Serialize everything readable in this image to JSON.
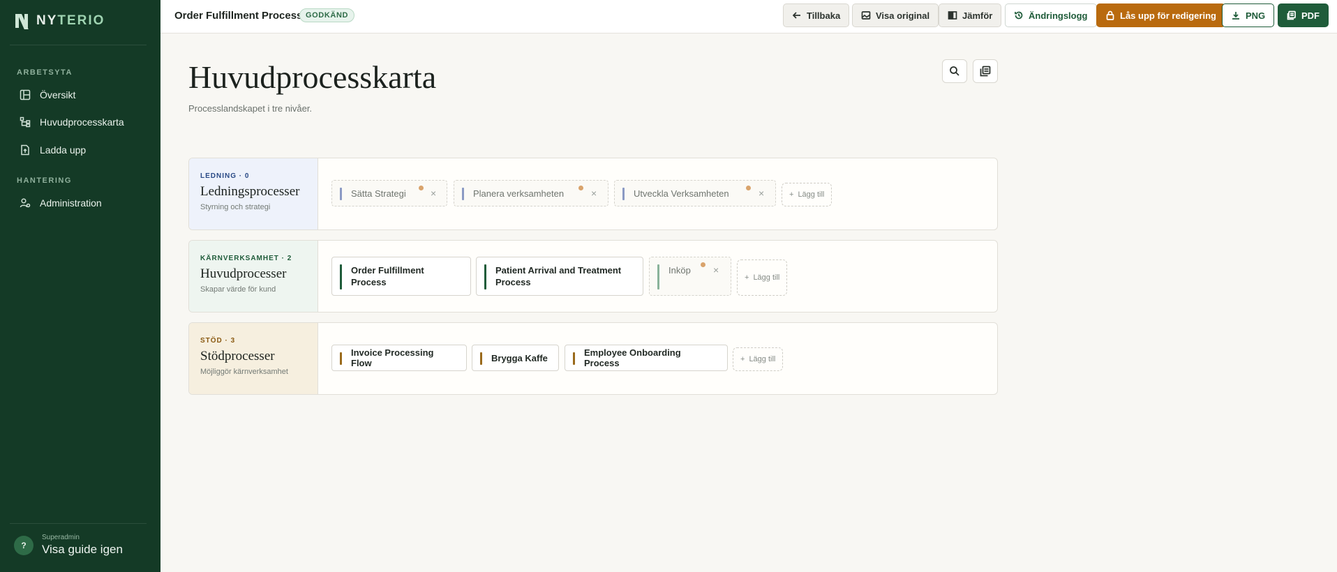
{
  "brand": {
    "part1": "NY",
    "part2": "TERIO"
  },
  "sidebar": {
    "sections": [
      {
        "label": "ARBETSYTA"
      },
      {
        "label": "HANTERING"
      }
    ],
    "items": [
      {
        "label": "Översikt",
        "icon": "grid-icon"
      },
      {
        "label": "Huvudprocesskarta",
        "icon": "hierarchy-icon"
      },
      {
        "label": "Ladda upp",
        "icon": "file-upload-icon"
      },
      {
        "label": "Administration",
        "icon": "users-icon"
      }
    ],
    "footer": {
      "help_glyph": "?",
      "sub": "Superadmin",
      "main": "Visa guide igen"
    }
  },
  "topbar": {
    "title": "Order Fulfillment Process",
    "badge": "GODKÄND",
    "buttons": {
      "back": "Tillbaka",
      "original": "Visa original",
      "compare": "Jämför",
      "changelog": "Ändringslogg",
      "unlock": "Lås upp för redigering",
      "png": "PNG",
      "pdf": "PDF"
    }
  },
  "main": {
    "title": "Huvudprocesskarta",
    "subtitle": "Processlandskapet i tre nivåer.",
    "add_label": "Lägg till",
    "rows": [
      {
        "tag": "LEDNING · 0",
        "name": "Ledningsprocesser",
        "desc": "Styrning och strategi",
        "tag_color": "#2a4a86",
        "bg": "#eef2fb",
        "bar_color": "#8b9ac4",
        "cards": [
          "Sätta Strategi",
          "Planera verksamheten",
          "Utveckla Verksamheten"
        ]
      },
      {
        "tag": "KÄRNVERKSAMHET · 2",
        "name": "Huvudprocesser",
        "desc": "Skapar värde för kund",
        "tag_color": "#1f5c3a",
        "bg": "#eef5f0",
        "bar_color": "#1f5c3a",
        "cards": [
          "Order Fulfillment Process",
          "Patient Arrival and Treatment Process",
          "Inköp"
        ]
      },
      {
        "tag": "STÖD · 3",
        "name": "Stödprocesser",
        "desc": "Möjliggör kärnverksamhet",
        "tag_color": "#8a5a12",
        "bg": "#f6efdf",
        "bar_color": "#9a6a1c",
        "cards": [
          "Invoice Processing Flow",
          "Brygga Kaffe",
          "Employee Onboarding Process"
        ]
      }
    ]
  }
}
